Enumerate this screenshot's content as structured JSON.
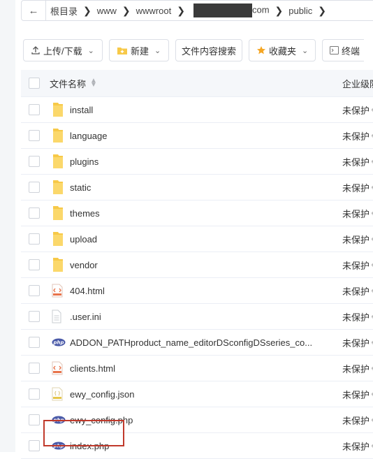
{
  "breadcrumb": {
    "items": [
      "根目录",
      "www",
      "wwwroot",
      "com",
      "public"
    ]
  },
  "toolbar": {
    "upload_label": "上传/下载",
    "new_label": "新建",
    "search_content_label": "文件内容搜索",
    "favorites_label": "收藏夹",
    "terminal_label": "终端"
  },
  "table": {
    "col_name": "文件名称",
    "col_protection": "企业级防",
    "rows": [
      {
        "name": "install",
        "type": "folder",
        "protection": "未保护"
      },
      {
        "name": "language",
        "type": "folder",
        "protection": "未保护"
      },
      {
        "name": "plugins",
        "type": "folder",
        "protection": "未保护"
      },
      {
        "name": "static",
        "type": "folder",
        "protection": "未保护"
      },
      {
        "name": "themes",
        "type": "folder",
        "protection": "未保护"
      },
      {
        "name": "upload",
        "type": "folder",
        "protection": "未保护"
      },
      {
        "name": "vendor",
        "type": "folder",
        "protection": "未保护"
      },
      {
        "name": "404.html",
        "type": "html",
        "protection": "未保护"
      },
      {
        "name": ".user.ini",
        "type": "file",
        "protection": "未保护"
      },
      {
        "name": "ADDON_PATHproduct_name_editorDSconfigDSseries_co...",
        "type": "php",
        "protection": "未保护"
      },
      {
        "name": "clients.html",
        "type": "html",
        "protection": "未保护"
      },
      {
        "name": "ewy_config.json",
        "type": "json",
        "protection": "未保护"
      },
      {
        "name": "ewy_config.php",
        "type": "php",
        "protection": "未保护"
      },
      {
        "name": "index.php",
        "type": "php",
        "protection": "未保护"
      }
    ]
  },
  "colors": {
    "folder": "#f7c948",
    "php": "#4a5aa8",
    "html": "#e8734a",
    "highlight": "#c0392b"
  }
}
